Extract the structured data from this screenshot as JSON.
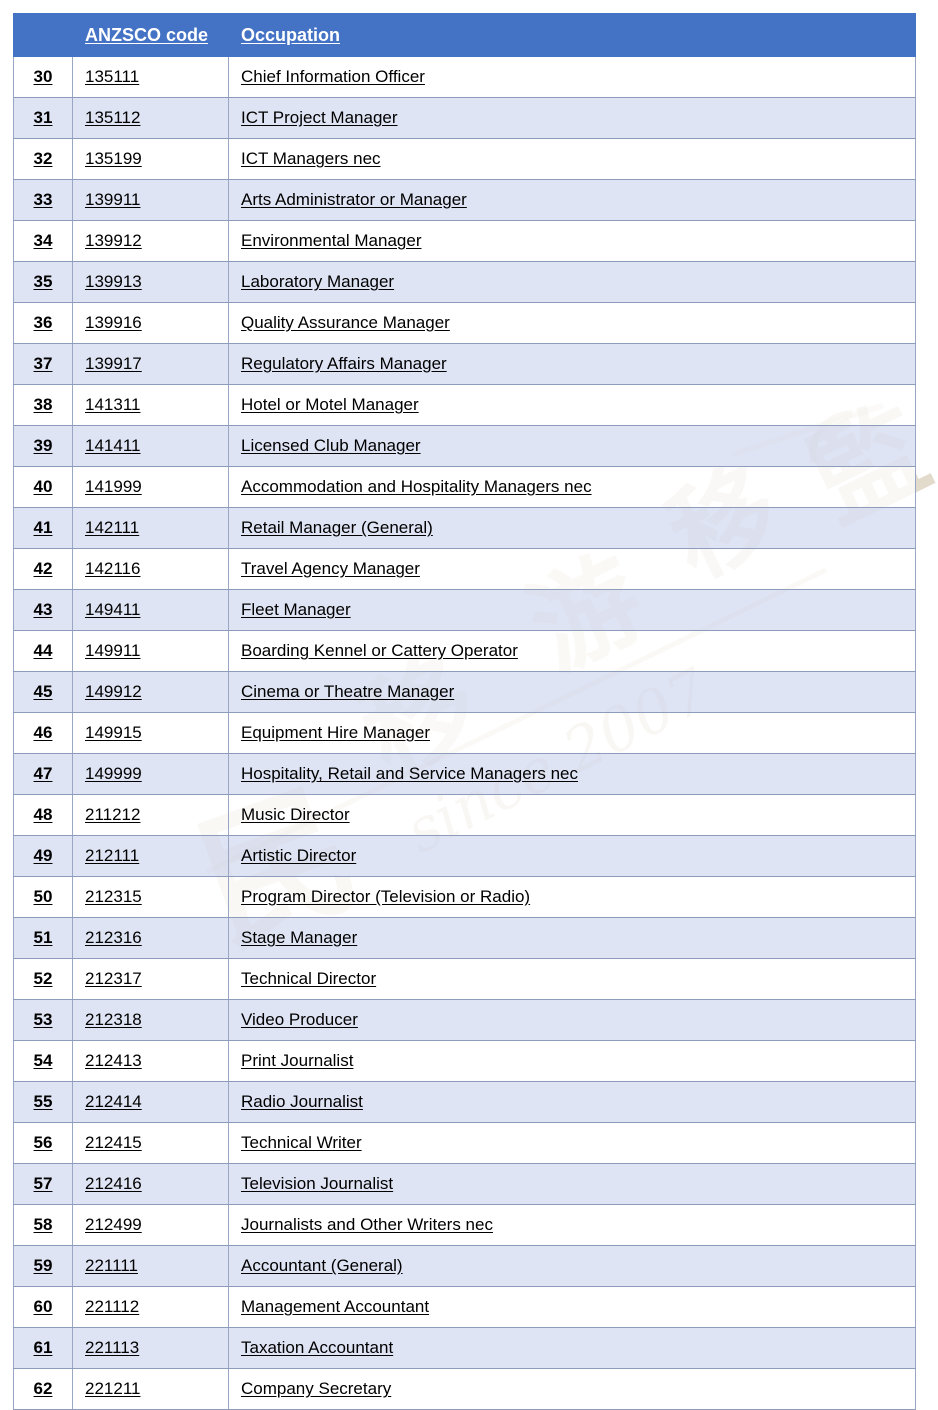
{
  "document": {
    "type": "occupation-list-table",
    "watermark": {
      "cjk_text": "移民留学",
      "since_text": "since 2007",
      "color": "#b8a882"
    },
    "colors": {
      "header_background": "#4472C4",
      "header_text": "#FFFFFF",
      "row_alt_background": "#DBE0F2",
      "row_background": "#FFFFFF",
      "border": "#8E9CBB",
      "text": "#000000"
    }
  },
  "table": {
    "columns": [
      {
        "key": "index",
        "label": ""
      },
      {
        "key": "code",
        "label": "ANZSCO code"
      },
      {
        "key": "occupation",
        "label": "Occupation"
      }
    ],
    "rows": [
      {
        "index": "30",
        "code": "135111",
        "occupation": "Chief Information Officer"
      },
      {
        "index": "31",
        "code": "135112",
        "occupation": "ICT Project Manager"
      },
      {
        "index": "32",
        "code": "135199",
        "occupation": "ICT Managers nec"
      },
      {
        "index": "33",
        "code": "139911",
        "occupation": "Arts Administrator or Manager"
      },
      {
        "index": "34",
        "code": "139912",
        "occupation": "Environmental Manager"
      },
      {
        "index": "35",
        "code": "139913",
        "occupation": "Laboratory Manager"
      },
      {
        "index": "36",
        "code": "139916",
        "occupation": "Quality Assurance Manager"
      },
      {
        "index": "37",
        "code": "139917",
        "occupation": "Regulatory Affairs Manager"
      },
      {
        "index": "38",
        "code": "141311",
        "occupation": "Hotel or Motel Manager"
      },
      {
        "index": "39",
        "code": "141411",
        "occupation": "Licensed Club Manager"
      },
      {
        "index": "40",
        "code": "141999",
        "occupation": "Accommodation and Hospitality Managers nec"
      },
      {
        "index": "41",
        "code": "142111",
        "occupation": "Retail Manager (General)"
      },
      {
        "index": "42",
        "code": "142116",
        "occupation": "Travel Agency Manager"
      },
      {
        "index": "43",
        "code": "149411",
        "occupation": "Fleet Manager"
      },
      {
        "index": "44",
        "code": "149911",
        "occupation": "Boarding Kennel or Cattery Operator"
      },
      {
        "index": "45",
        "code": "149912",
        "occupation": "Cinema or Theatre Manager"
      },
      {
        "index": "46",
        "code": "149915",
        "occupation": "Equipment Hire Manager"
      },
      {
        "index": "47",
        "code": "149999",
        "occupation": "Hospitality, Retail and Service Managers nec"
      },
      {
        "index": "48",
        "code": "211212",
        "occupation": "Music Director"
      },
      {
        "index": "49",
        "code": "212111",
        "occupation": "Artistic Director"
      },
      {
        "index": "50",
        "code": "212315",
        "occupation": "Program Director (Television or Radio)"
      },
      {
        "index": "51",
        "code": "212316",
        "occupation": "Stage Manager"
      },
      {
        "index": "52",
        "code": "212317",
        "occupation": "Technical Director"
      },
      {
        "index": "53",
        "code": "212318",
        "occupation": "Video Producer"
      },
      {
        "index": "54",
        "code": "212413",
        "occupation": "Print Journalist"
      },
      {
        "index": "55",
        "code": "212414",
        "occupation": "Radio Journalist"
      },
      {
        "index": "56",
        "code": "212415",
        "occupation": "Technical Writer"
      },
      {
        "index": "57",
        "code": "212416",
        "occupation": "Television Journalist"
      },
      {
        "index": "58",
        "code": "212499",
        "occupation": "Journalists and Other Writers nec"
      },
      {
        "index": "59",
        "code": "221111",
        "occupation": "Accountant (General)"
      },
      {
        "index": "60",
        "code": "221112",
        "occupation": "Management Accountant"
      },
      {
        "index": "61",
        "code": "221113",
        "occupation": "Taxation Accountant"
      },
      {
        "index": "62",
        "code": "221211",
        "occupation": "Company Secretary"
      }
    ]
  }
}
